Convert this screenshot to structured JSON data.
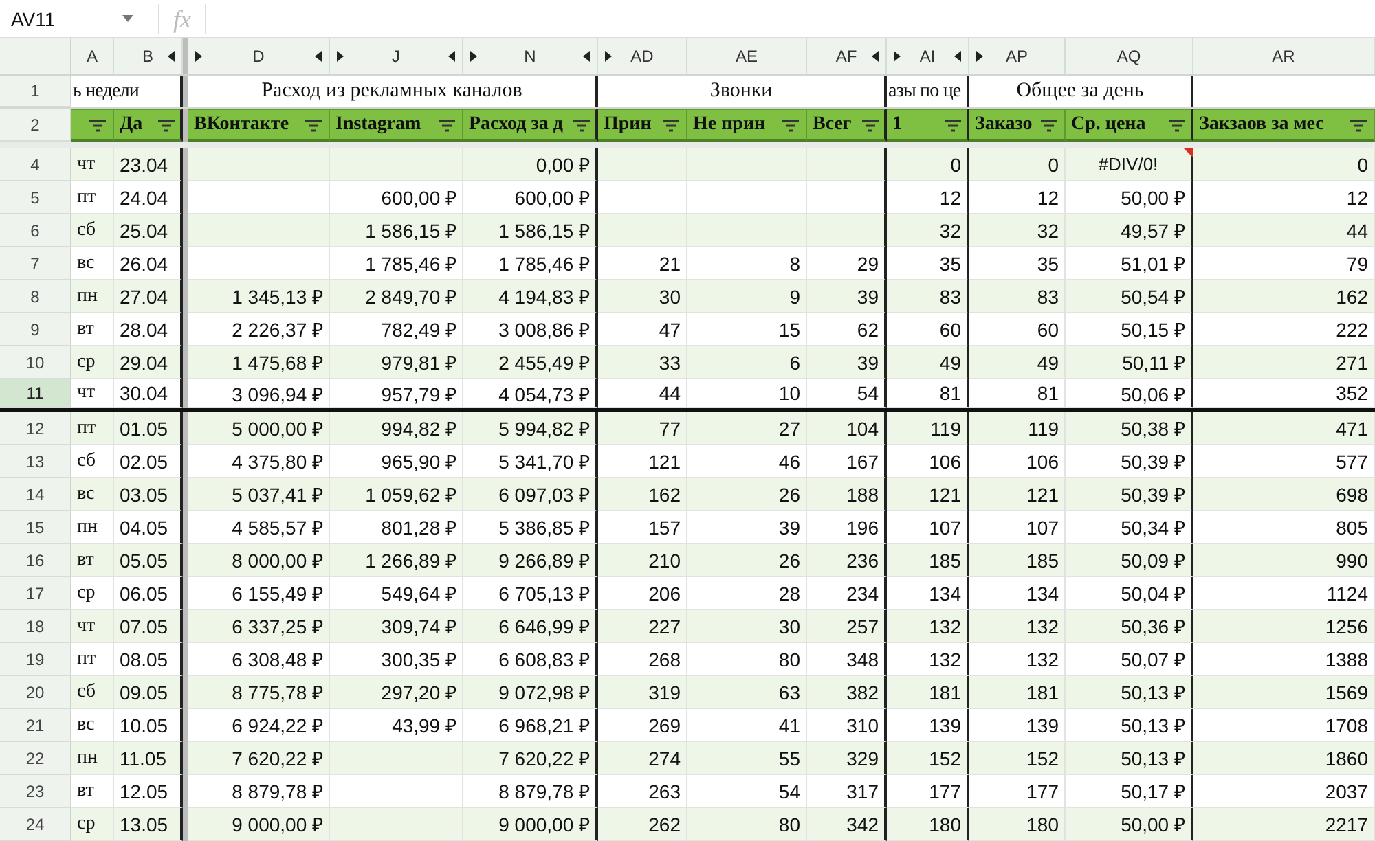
{
  "formula_bar": {
    "name_box": "AV11",
    "fx": "fx"
  },
  "columns": [
    {
      "label": "A",
      "kind": "weekday",
      "hidden_before": false,
      "hidden_after": false,
      "group_heading": "ь недели",
      "heading_cut": true,
      "group_end": false
    },
    {
      "label": "B",
      "kind": "date",
      "hidden_before": false,
      "hidden_after": true,
      "filter": "Да",
      "group_end": true
    },
    {
      "label": "D",
      "kind": "number",
      "hidden_before": true,
      "hidden_after": true,
      "filter": "ВКонтакте",
      "group_heading": "Расход из рекламных каналов",
      "heading_cut": false,
      "group_end": false
    },
    {
      "label": "J",
      "kind": "number",
      "hidden_before": true,
      "hidden_after": true,
      "filter": "Instagram",
      "group_end": false
    },
    {
      "label": "N",
      "kind": "number",
      "hidden_before": true,
      "hidden_after": true,
      "filter": "Расход за д",
      "group_end": true
    },
    {
      "label": "AD",
      "kind": "number",
      "hidden_before": true,
      "hidden_after": false,
      "filter": "Прин",
      "group_heading": "Звонки",
      "heading_cut": false,
      "group_end": false
    },
    {
      "label": "AE",
      "kind": "number",
      "hidden_before": false,
      "hidden_after": false,
      "filter": "Не прин",
      "group_end": false
    },
    {
      "label": "AF",
      "kind": "number",
      "hidden_before": false,
      "hidden_after": true,
      "filter": "Всег",
      "group_end": true
    },
    {
      "label": "AI",
      "kind": "number",
      "hidden_before": true,
      "hidden_after": true,
      "filter": "1",
      "group_heading": "азы по це",
      "heading_cut": true,
      "group_end": true
    },
    {
      "label": "AP",
      "kind": "number",
      "hidden_before": true,
      "hidden_after": false,
      "filter": "Заказо",
      "group_heading": "Общее за день",
      "heading_cut": false,
      "group_end": false
    },
    {
      "label": "AQ",
      "kind": "number",
      "hidden_before": false,
      "hidden_after": false,
      "filter": "Ср. цена",
      "group_end": true
    },
    {
      "label": "AR",
      "kind": "number",
      "hidden_before": false,
      "hidden_after": false,
      "filter": "Закзаов за мес",
      "group_end": false
    }
  ],
  "header_rows": [
    "1",
    "2"
  ],
  "rows": [
    {
      "number": "4",
      "selected": false,
      "cells": [
        "чт",
        "23.04",
        null,
        null,
        "0,00 ₽",
        null,
        null,
        null,
        "0",
        "0",
        {
          "text": "#DIV/0!",
          "kind": "error",
          "comment": true
        },
        "0"
      ]
    },
    {
      "number": "5",
      "selected": false,
      "cells": [
        "пт",
        "24.04",
        null,
        "600,00 ₽",
        "600,00 ₽",
        null,
        null,
        null,
        "12",
        "12",
        "50,00 ₽",
        "12"
      ]
    },
    {
      "number": "6",
      "selected": false,
      "cells": [
        "сб",
        "25.04",
        null,
        "1 586,15 ₽",
        "1 586,15 ₽",
        null,
        null,
        null,
        "32",
        "32",
        "49,57 ₽",
        "44"
      ]
    },
    {
      "number": "7",
      "selected": false,
      "cells": [
        "вс",
        "26.04",
        null,
        "1 785,46 ₽",
        "1 785,46 ₽",
        "21",
        "8",
        "29",
        "35",
        "35",
        "51,01 ₽",
        "79"
      ]
    },
    {
      "number": "8",
      "selected": false,
      "cells": [
        "пн",
        "27.04",
        "1 345,13 ₽",
        "2 849,70 ₽",
        "4 194,83 ₽",
        "30",
        "9",
        "39",
        "83",
        "83",
        "50,54 ₽",
        "162"
      ]
    },
    {
      "number": "9",
      "selected": false,
      "cells": [
        "вт",
        "28.04",
        "2 226,37 ₽",
        "782,49 ₽",
        "3 008,86 ₽",
        "47",
        "15",
        "62",
        "60",
        "60",
        "50,15 ₽",
        "222"
      ]
    },
    {
      "number": "10",
      "selected": false,
      "cells": [
        "ср",
        "29.04",
        "1 475,68 ₽",
        "979,81 ₽",
        "2 455,49 ₽",
        "33",
        "6",
        "39",
        "49",
        "49",
        "50,11 ₽",
        "271"
      ]
    },
    {
      "number": "11",
      "selected": true,
      "cells": [
        "чт",
        "30.04",
        "3 096,94 ₽",
        "957,79 ₽",
        "4 054,73 ₽",
        "44",
        "10",
        "54",
        "81",
        "81",
        "50,06 ₽",
        "352"
      ]
    },
    {
      "number": "12",
      "selected": false,
      "cells": [
        "пт",
        "01.05",
        "5 000,00 ₽",
        "994,82 ₽",
        "5 994,82 ₽",
        "77",
        "27",
        "104",
        "119",
        "119",
        "50,38 ₽",
        "471"
      ]
    },
    {
      "number": "13",
      "selected": false,
      "cells": [
        "сб",
        "02.05",
        "4 375,80 ₽",
        "965,90 ₽",
        "5 341,70 ₽",
        "121",
        "46",
        "167",
        "106",
        "106",
        "50,39 ₽",
        "577"
      ]
    },
    {
      "number": "14",
      "selected": false,
      "cells": [
        "вс",
        "03.05",
        "5 037,41 ₽",
        "1 059,62 ₽",
        "6 097,03 ₽",
        "162",
        "26",
        "188",
        "121",
        "121",
        "50,39 ₽",
        "698"
      ]
    },
    {
      "number": "15",
      "selected": false,
      "cells": [
        "пн",
        "04.05",
        "4 585,57 ₽",
        "801,28 ₽",
        "5 386,85 ₽",
        "157",
        "39",
        "196",
        "107",
        "107",
        "50,34 ₽",
        "805"
      ]
    },
    {
      "number": "16",
      "selected": false,
      "cells": [
        "вт",
        "05.05",
        "8 000,00 ₽",
        "1 266,89 ₽",
        "9 266,89 ₽",
        "210",
        "26",
        "236",
        "185",
        "185",
        "50,09 ₽",
        "990"
      ]
    },
    {
      "number": "17",
      "selected": false,
      "cells": [
        "ср",
        "06.05",
        "6 155,49 ₽",
        "549,64 ₽",
        "6 705,13 ₽",
        "206",
        "28",
        "234",
        "134",
        "134",
        "50,04 ₽",
        "1124"
      ]
    },
    {
      "number": "18",
      "selected": false,
      "cells": [
        "чт",
        "07.05",
        "6 337,25 ₽",
        "309,74 ₽",
        "6 646,99 ₽",
        "227",
        "30",
        "257",
        "132",
        "132",
        "50,36 ₽",
        "1256"
      ]
    },
    {
      "number": "19",
      "selected": false,
      "cells": [
        "пт",
        "08.05",
        "6 308,48 ₽",
        "300,35 ₽",
        "6 608,83 ₽",
        "268",
        "80",
        "348",
        "132",
        "132",
        "50,07 ₽",
        "1388"
      ]
    },
    {
      "number": "20",
      "selected": false,
      "cells": [
        "сб",
        "09.05",
        "8 775,78 ₽",
        "297,20 ₽",
        "9 072,98 ₽",
        "319",
        "63",
        "382",
        "181",
        "181",
        "50,13 ₽",
        "1569"
      ]
    },
    {
      "number": "21",
      "selected": false,
      "cells": [
        "вс",
        "10.05",
        "6 924,22 ₽",
        "43,99 ₽",
        "6 968,21 ₽",
        "269",
        "41",
        "310",
        "139",
        "139",
        "50,13 ₽",
        "1708"
      ]
    },
    {
      "number": "22",
      "selected": false,
      "cells": [
        "пн",
        "11.05",
        "7 620,22 ₽",
        null,
        "7 620,22 ₽",
        "274",
        "55",
        "329",
        "152",
        "152",
        "50,13 ₽",
        "1860"
      ]
    },
    {
      "number": "23",
      "selected": false,
      "cells": [
        "вт",
        "12.05",
        "8 879,78 ₽",
        null,
        "8 879,78 ₽",
        "263",
        "54",
        "317",
        "177",
        "177",
        "50,17 ₽",
        "2037"
      ]
    },
    {
      "number": "24",
      "selected": false,
      "cells": [
        "ср",
        "13.05",
        "9 000,00 ₽",
        null,
        "9 000,00 ₽",
        "262",
        "80",
        "342",
        "180",
        "180",
        "50,00 ₽",
        "2217"
      ]
    }
  ]
}
